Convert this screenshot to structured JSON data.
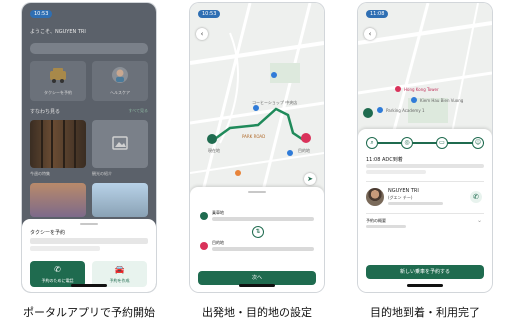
{
  "screens": [
    {
      "status_time": "10:53",
      "greeting": "ようこそ、NGUYEN TRI",
      "services": [
        "タクシーを予約",
        "ヘルスケア"
      ],
      "section_title": "すなわち見る",
      "section_more": "すべて見る",
      "thumb_labels": [
        "今週の特集",
        "観光の紹介"
      ],
      "sheet": {
        "title": "タクシーを予約",
        "call_button": "予約のために電話",
        "app_button": "予約を作成"
      }
    },
    {
      "status_time": "10:53",
      "map_labels": {
        "poi_1": "コーヒーショップ 中央店",
        "poi_2": "PARK ROAD",
        "pickup_tag": "現在地",
        "dest_tag": "目的地"
      },
      "pickup": {
        "title": "乗車地"
      },
      "destination": {
        "title": "目的地"
      },
      "next_button": "次へ"
    },
    {
      "status_time": "11:08",
      "map_labels": {
        "poi_1": "Hong Kong Tower",
        "poi_2": "Kiem Hau Bien Vuong",
        "poi_3": "Parking Academy 1"
      },
      "status_title": "11:08 ADC到着",
      "driver": {
        "name": "NGUYEN TRI",
        "kana": "(グエン チー)"
      },
      "reservation_title": "予約の概要",
      "new_ride_button": "新しい乗車を予約する"
    }
  ],
  "captions": [
    "ポータルアプリで予約開始",
    "出発地・目的地の設定",
    "目的地到着・利用完了"
  ],
  "colors": {
    "brand_green": "#1f6b4f",
    "route_green": "#1f8a5a",
    "pin_red": "#d9325a"
  },
  "icons": [
    "back-icon",
    "phone-icon",
    "car-icon",
    "location-icon",
    "swap-icon",
    "search-icon"
  ]
}
